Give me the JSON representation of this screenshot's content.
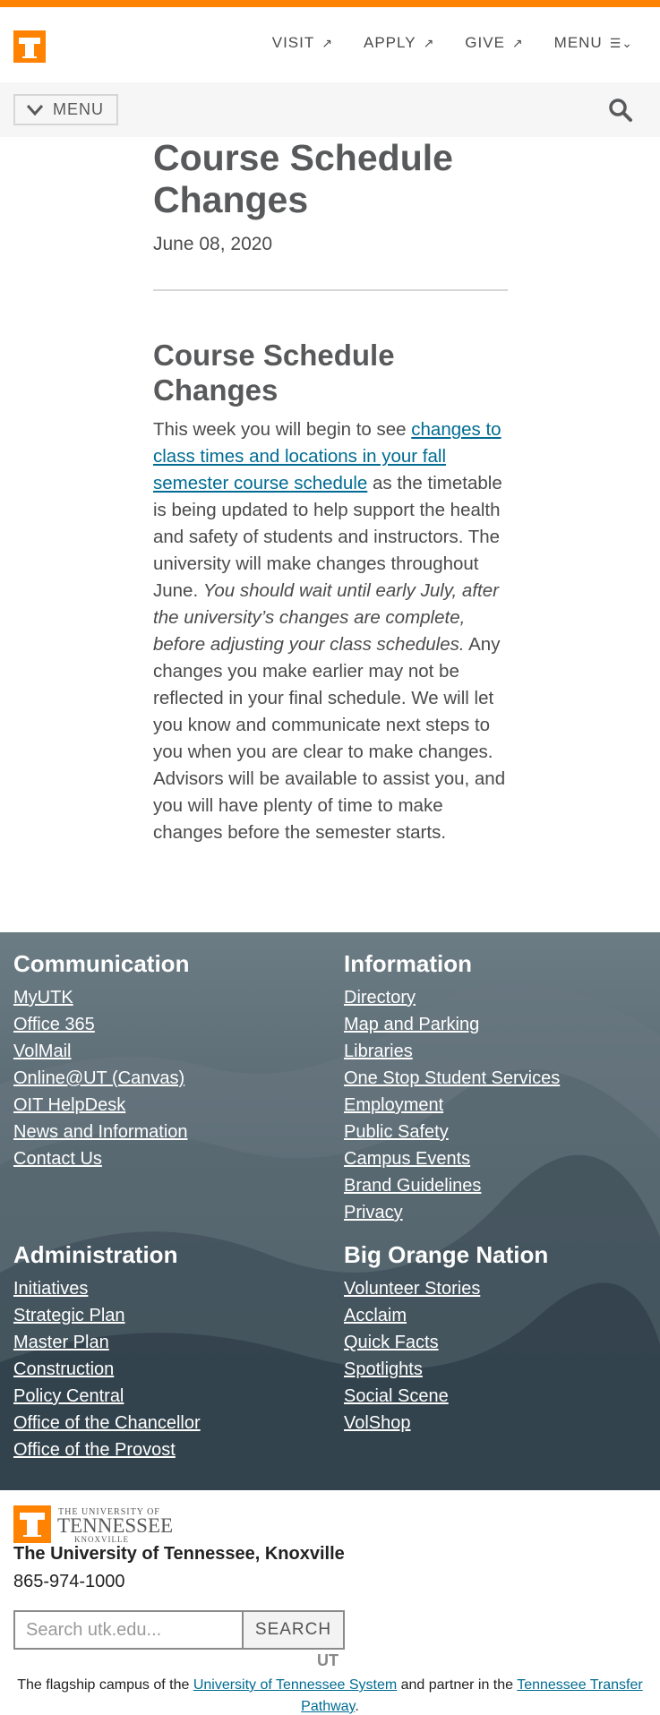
{
  "brand": {
    "orange": "#ff8200",
    "link": "#006c93"
  },
  "topnav": [
    {
      "label": "VISIT",
      "icon": "external-arrow-icon"
    },
    {
      "label": "APPLY",
      "icon": "external-arrow-icon"
    },
    {
      "label": "GIVE",
      "icon": "external-arrow-icon"
    },
    {
      "label": "MENU",
      "icon": "menu-lines-icon"
    }
  ],
  "subbar": {
    "menu_label": "MENU",
    "search_icon": "search-icon"
  },
  "article": {
    "title": "Course Schedule Changes",
    "date": "June 08, 2020",
    "heading": "Course Schedule Changes",
    "intro": "This week you will begin to see ",
    "link_text": "changes to class times and locations in your fall semester course schedule",
    "after_link": " as the timetable is being updated to help support the health and safety of students and instructors. The university will make changes throughout June. ",
    "italic": "You should wait until early July, after the university’s changes are complete, before adjusting your class schedules.",
    "rest": " Any changes you make earlier may not be reflected in your final schedule. We will let you know and communicate next steps to you when you are clear to make changes. Advisors will be available to assist you, and you will have plenty of time to make changes before the semester starts."
  },
  "footer": {
    "communication": {
      "title": "Communication",
      "links": [
        "MyUTK",
        "Office 365",
        "VolMail",
        "Online@UT (Canvas)",
        "OIT HelpDesk",
        "News and Information",
        "Contact Us"
      ]
    },
    "information": {
      "title": "Information",
      "links": [
        "Directory",
        "Map and Parking",
        "Libraries",
        "One Stop Student Services",
        "Employment",
        "Public Safety",
        "Campus Events",
        "Brand Guidelines",
        "Privacy"
      ]
    },
    "administration": {
      "title": "Administration",
      "links": [
        "Initiatives",
        "Strategic Plan",
        "Master Plan",
        "Construction",
        "Policy Central",
        "Office of the Chancellor",
        "Office of the Provost"
      ]
    },
    "big_orange": {
      "title": "Big Orange Nation",
      "links": [
        "Volunteer Stories",
        "Acclaim",
        "Quick Facts",
        "Spotlights",
        "Social Scene",
        "VolShop"
      ]
    }
  },
  "bottom": {
    "wordmark_line1": "THE UNIVERSITY OF",
    "wordmark_line2": "TENNESSEE",
    "wordmark_line3": "KNOXVILLE",
    "name": "The University of Tennessee, Knoxville",
    "phone": "865-974-1000",
    "search_placeholder": "Search utk.edu...",
    "search_button": "SEARCH",
    "ut_mark": "UT",
    "tagline_pre": "The flagship campus of the ",
    "tagline_link1": "University of Tennessee System",
    "tagline_mid": " and partner in the ",
    "tagline_link2": "Tennessee Transfer Pathway",
    "tagline_post": "."
  }
}
